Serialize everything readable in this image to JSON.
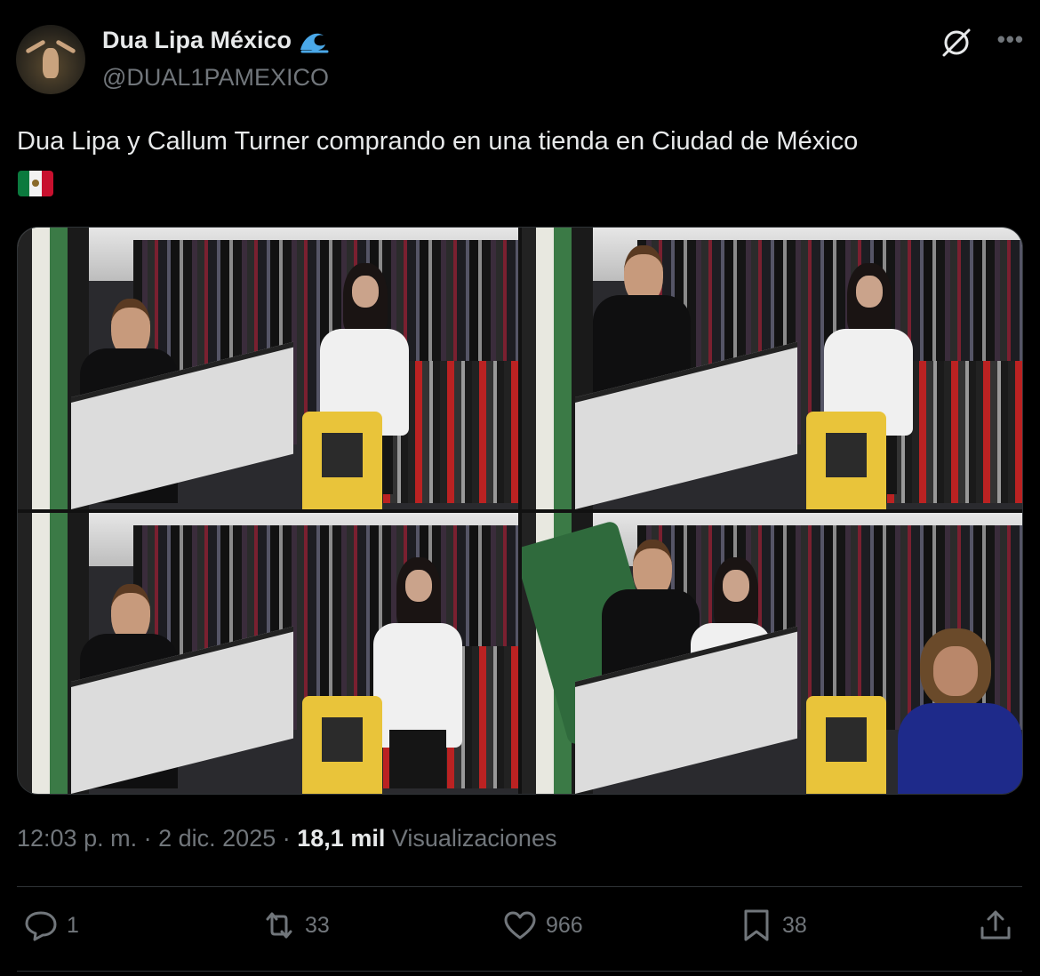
{
  "author": {
    "display_name": "Dua Lipa México",
    "handle": "@DUAL1PAMEXICO",
    "badge_icon": "wave-icon"
  },
  "post": {
    "text": "Dua Lipa y Callum Turner comprando en una tienda en Ciudad de México",
    "emoji": "mexico-flag"
  },
  "meta": {
    "time": "12:03 p. m.",
    "separator": "·",
    "date": "2 dic. 2025",
    "views_count": "18,1 mil",
    "views_label": "Visualizaciones"
  },
  "actions": {
    "replies": "1",
    "reposts": "33",
    "likes": "966",
    "bookmarks": "38"
  },
  "colors": {
    "background": "#000000",
    "text_primary": "#e7e9ea",
    "text_secondary": "#71767b",
    "divider": "#2f3336",
    "wave_badge": "#4aa8e8"
  }
}
